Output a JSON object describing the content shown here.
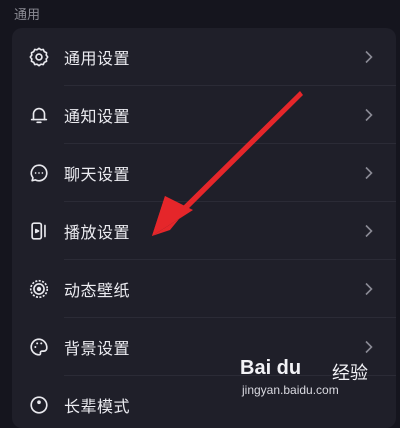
{
  "section": {
    "label": "通用"
  },
  "items": [
    {
      "label": "通用设置",
      "icon": "gear-icon"
    },
    {
      "label": "通知设置",
      "icon": "bell-icon"
    },
    {
      "label": "聊天设置",
      "icon": "chat-bubble-icon"
    },
    {
      "label": "播放设置",
      "icon": "play-device-icon"
    },
    {
      "label": "动态壁纸",
      "icon": "wallpaper-icon"
    },
    {
      "label": "背景设置",
      "icon": "palette-icon"
    },
    {
      "label": "长辈模式",
      "icon": "elder-mode-icon"
    }
  ],
  "watermark": {
    "logo": "Bai du",
    "logo_mid": "经验",
    "url": "jingyan.baidu.com"
  },
  "colors": {
    "background": "#15151e",
    "card": "#1f1f29",
    "text": "#ececf1",
    "section_label": "#8b8b94",
    "chevron": "#8a8a94",
    "annotation_arrow": "#e5262a"
  }
}
